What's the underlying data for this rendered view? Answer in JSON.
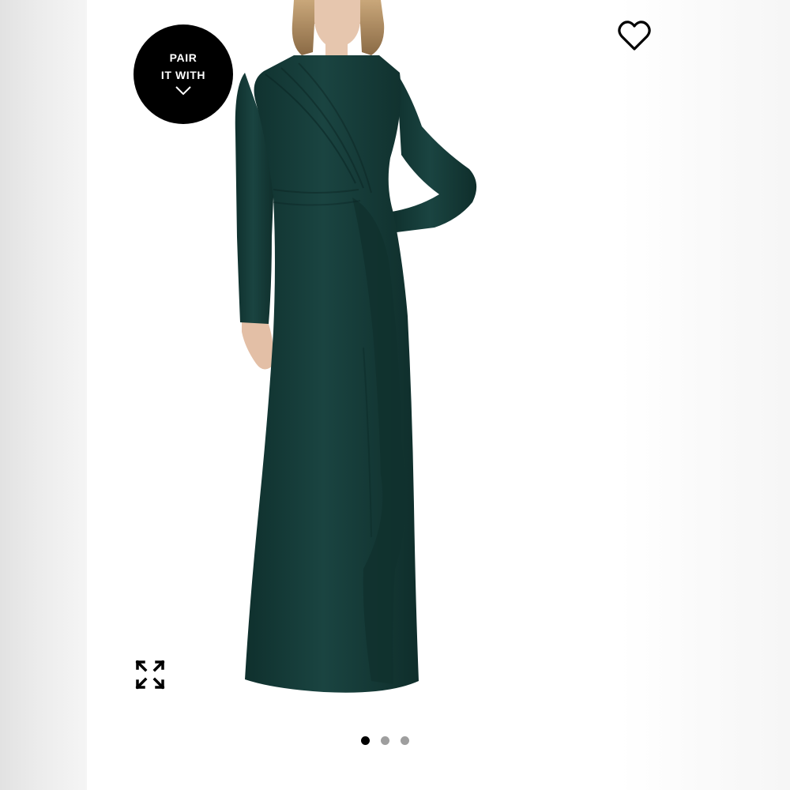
{
  "badge": {
    "line1": "PAIR",
    "line2": "IT WITH",
    "icon": "chevron-down-icon"
  },
  "icons": {
    "wishlist": "heart-outline-icon",
    "expand": "fullscreen-expand-icon"
  },
  "carousel": {
    "total": 3,
    "active_index": 0
  },
  "colors": {
    "dress": "#153b38",
    "badge_bg": "#000000",
    "active_dot": "#000000",
    "inactive_dot": "#9e9e9e"
  }
}
